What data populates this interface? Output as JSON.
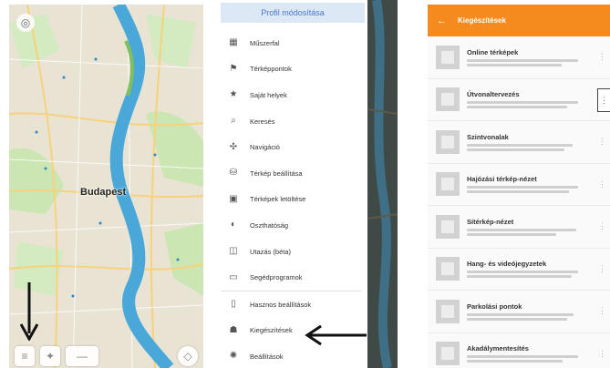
{
  "map_panel": {
    "city_label": "Budapest",
    "compass_icon": "compass-icon",
    "bottom_buttons": [
      "menu-icon",
      "location-icon",
      "zoom-icon",
      "navigation-icon"
    ],
    "colors": {
      "land": "#e9e3d4",
      "river": "#4aa8d8",
      "park": "#bfe3a6",
      "road": "#f7c85a"
    }
  },
  "drawer_panel": {
    "header": "Profil módosítása",
    "menu_items": [
      {
        "label": "Műszerfal",
        "icon": "dashboard-icon"
      },
      {
        "label": "Térképpontok",
        "icon": "pin-icon"
      },
      {
        "label": "Saját helyek",
        "icon": "star-icon"
      },
      {
        "label": "Keresés",
        "icon": "search-icon"
      },
      {
        "label": "Navigáció",
        "icon": "navigation-icon"
      },
      {
        "label": "Térkép beállítása",
        "icon": "layers-icon"
      },
      {
        "label": "Térképek letöltése",
        "icon": "download-icon"
      },
      {
        "label": "Oszthatóság",
        "icon": "share-icon"
      },
      {
        "label": "Utazás (béta)",
        "icon": "travel-icon"
      },
      {
        "label": "Segédprogramok",
        "icon": "tools-icon"
      },
      {
        "label": "Hasznos beállítások",
        "icon": "settings-icon"
      },
      {
        "label": "Kiegészítések",
        "icon": "plugins-icon"
      },
      {
        "label": "Beállítások",
        "icon": "gear-icon"
      }
    ],
    "colors": {
      "header_bg": "#dde8f7",
      "header_text": "#4a78c5",
      "overlay": "#3f4a46"
    }
  },
  "list_panel": {
    "title": "Kiegészítések",
    "items": [
      {
        "title": "Online térképek"
      },
      {
        "title": "Útvonaltervezés"
      },
      {
        "title": "Szintvonalak"
      },
      {
        "title": "Hajózási térkép-nézet"
      },
      {
        "title": "Sítérkép-nézet"
      },
      {
        "title": "Hang- és videójegyzetek"
      },
      {
        "title": "Parkolási pontok"
      },
      {
        "title": "Akadálymentesítés"
      }
    ],
    "colors": {
      "header_bg": "#f58a1f"
    }
  }
}
